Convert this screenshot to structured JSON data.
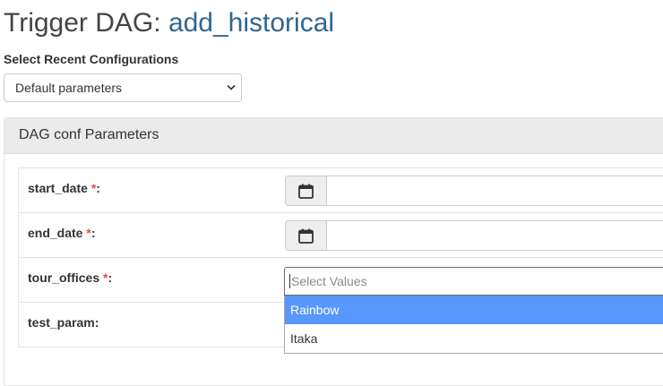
{
  "header": {
    "title_prefix": "Trigger DAG:",
    "dag_name": "add_historical"
  },
  "recent_configs": {
    "label": "Select Recent Configurations",
    "selected": "Default parameters"
  },
  "panel": {
    "heading": "DAG conf Parameters",
    "params": [
      {
        "name": "start_date",
        "required_mark": "*",
        "suffix": ":",
        "type": "date",
        "value": ""
      },
      {
        "name": "end_date",
        "required_mark": "*",
        "suffix": ":",
        "type": "date",
        "value": ""
      },
      {
        "name": "tour_offices",
        "required_mark": "*",
        "suffix": ":",
        "type": "multiselect",
        "placeholder": "Select Values"
      },
      {
        "name": "test_param",
        "required_mark": "",
        "suffix": ":",
        "type": "text",
        "value": ""
      }
    ]
  },
  "dropdown": {
    "options": [
      "Rainbow",
      "Itaka"
    ],
    "highlighted_index": 0
  },
  "colors": {
    "link_blue": "#31668f",
    "required_red": "#d9534f",
    "highlight_blue": "#5897fb",
    "panel_heading_bg": "#ebebeb"
  },
  "icons": {
    "date_addon": "calendar-icon",
    "select_toggle": "chevron-down-icon"
  }
}
